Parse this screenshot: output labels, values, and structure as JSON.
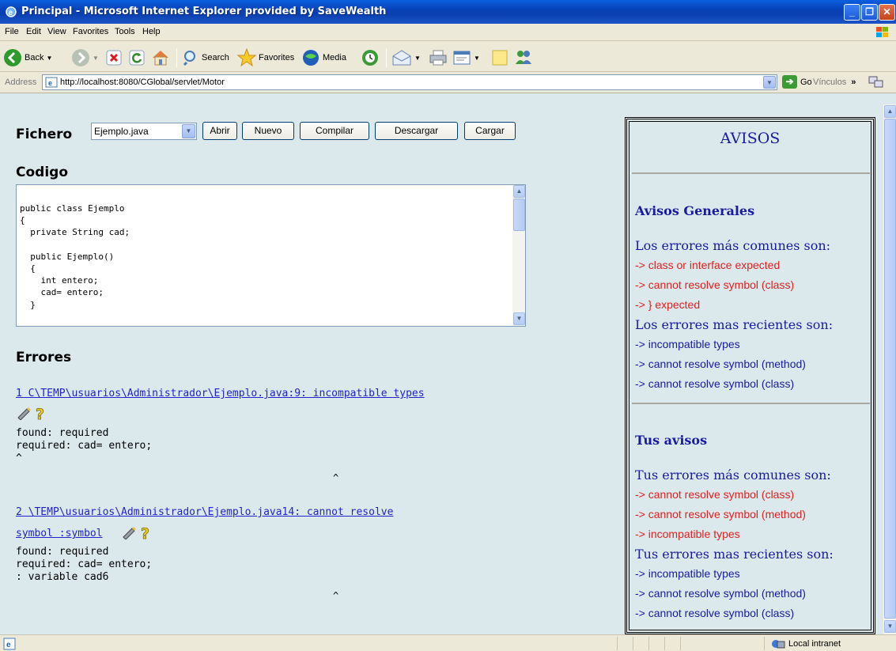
{
  "window": {
    "title": "Principal - Microsoft Internet Explorer provided by SaveWealth"
  },
  "menu": [
    "File",
    "Edit",
    "View",
    "Favorites",
    "Tools",
    "Help"
  ],
  "toolbar": {
    "back": "Back",
    "search": "Search",
    "favorites": "Favorites",
    "media": "Media"
  },
  "address": {
    "label": "Address",
    "url": "http://localhost:8080/CGlobal/servlet/Motor",
    "go": "Go",
    "links": "Vínculos",
    "links_more": "»"
  },
  "page": {
    "fichero_label": "Fichero",
    "fichero_selected": "Ejemplo.java",
    "buttons": {
      "abrir": "Abrir",
      "nuevo": "Nuevo",
      "compilar": "Compilar",
      "descargar": "Descargar",
      "cargar": "Cargar"
    },
    "codigo_label": "Codigo",
    "code": "public class Ejemplo\n{\n  private String cad;\n\n  public Ejemplo()\n  {\n    int entero;\n    cad= entero;\n  }",
    "errores_label": "Errores",
    "errors": [
      {
        "link": "1 C\\TEMP\\usuarios\\Administrador\\Ejemplo.java:9: incompatible types",
        "detail": "found: required\nrequired: cad= entero;\n^",
        "caret": "^"
      },
      {
        "link_line1": "2 \\TEMP\\usuarios\\Administrador\\Ejemplo.java14: cannot resolve",
        "link_line2": "symbol :symbol",
        "detail": "found: required\nrequired: cad= entero;\n: variable cad6",
        "caret": "^"
      }
    ]
  },
  "avisos": {
    "title": "AVISOS",
    "generales_heading": "Avisos Generales",
    "comunes_label": "Los errores más comunes son:",
    "comunes": [
      "-> class or interface expected",
      "-> cannot resolve symbol (class)",
      "-> } expected"
    ],
    "recientes_label": "Los errores mas recientes son:",
    "recientes": [
      "-> incompatible types",
      "-> cannot resolve symbol (method)",
      "-> cannot resolve symbol (class)"
    ],
    "tus_heading": "Tus avisos",
    "tus_comunes_label": "Tus errores más comunes son:",
    "tus_comunes": [
      "-> cannot resolve symbol (class)",
      "-> cannot resolve symbol (method)",
      "-> incompatible types"
    ],
    "tus_recientes_label": "Tus errores mas recientes son:",
    "tus_recientes": [
      "-> incompatible types",
      "-> cannot resolve symbol (method)",
      "-> cannot resolve symbol (class)"
    ]
  },
  "status": {
    "zone": "Local intranet"
  }
}
